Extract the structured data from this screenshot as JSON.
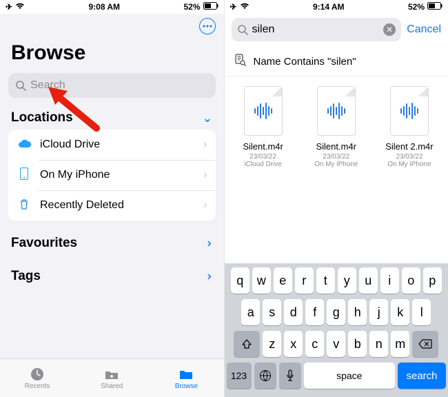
{
  "left": {
    "status": {
      "time": "9:08 AM",
      "battery": "52%"
    },
    "title": "Browse",
    "search_placeholder": "Search",
    "sections": {
      "locations": {
        "title": "Locations"
      },
      "favourites": {
        "title": "Favourites"
      },
      "tags": {
        "title": "Tags"
      }
    },
    "locations": [
      {
        "label": "iCloud Drive"
      },
      {
        "label": "On My iPhone"
      },
      {
        "label": "Recently Deleted"
      }
    ],
    "tabs": {
      "recents": "Recents",
      "shared": "Shared",
      "browse": "Browse"
    }
  },
  "right": {
    "status": {
      "time": "9:14 AM",
      "battery": "52%"
    },
    "search_value": "silen",
    "cancel": "Cancel",
    "suggestion": "Name Contains \"silen\"",
    "results": [
      {
        "name": "Silent.m4r",
        "date": "23/03/22",
        "loc": "iCloud Drive"
      },
      {
        "name": "Silent.m4r",
        "date": "23/03/22",
        "loc": "On My iPhone"
      },
      {
        "name": "Silent 2.m4r",
        "date": "23/03/22",
        "loc": "On My iPhone"
      }
    ],
    "keyboard": {
      "row1": [
        "q",
        "w",
        "e",
        "r",
        "t",
        "y",
        "u",
        "i",
        "o",
        "p"
      ],
      "row2": [
        "a",
        "s",
        "d",
        "f",
        "g",
        "h",
        "j",
        "k",
        "l"
      ],
      "row3": [
        "z",
        "x",
        "c",
        "v",
        "b",
        "n",
        "m"
      ],
      "num": "123",
      "space": "space",
      "search": "search"
    }
  }
}
